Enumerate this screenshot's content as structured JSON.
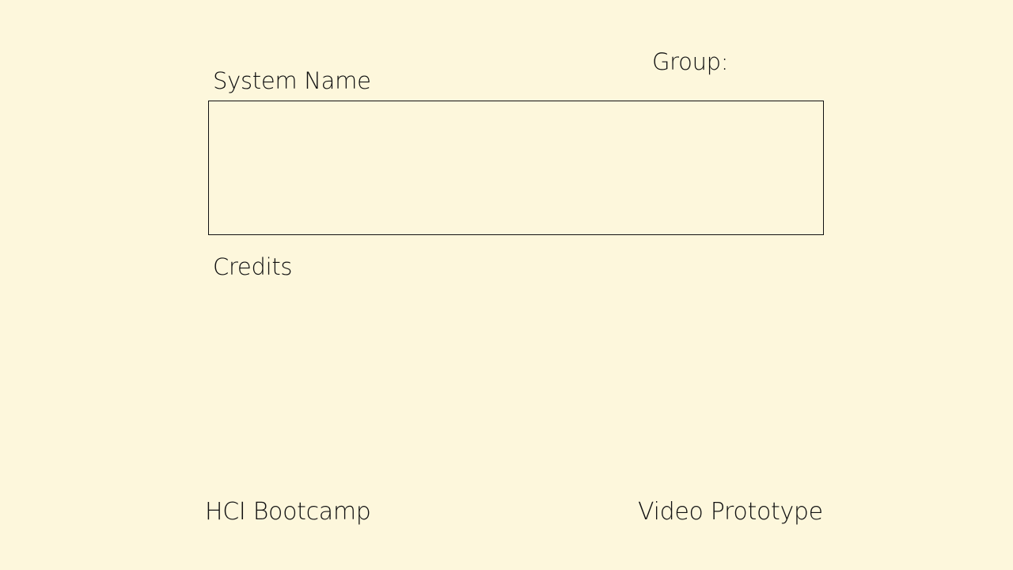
{
  "slide": {
    "group_label": "Group:",
    "system_name_label": "System Name",
    "credits_label": "Credits",
    "footer_left": "HCI Bootcamp",
    "footer_right": "Video Prototype"
  },
  "colors": {
    "background": "#fdf7dc",
    "text": "#111111",
    "box_border": "#111111"
  }
}
